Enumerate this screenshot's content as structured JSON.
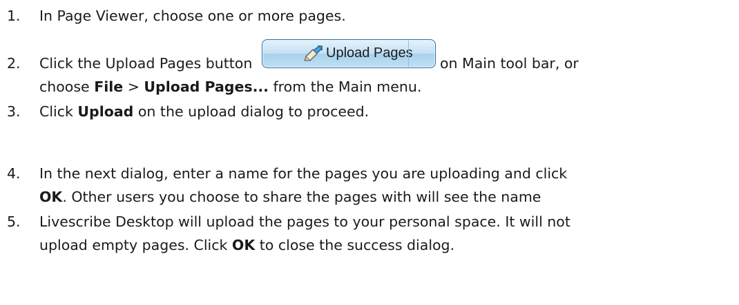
{
  "steps": [
    {
      "number": "1.",
      "text": "In Page Viewer, choose one or more pages."
    },
    {
      "number": "2.",
      "text_before_button": "Click the Upload Pages button",
      "button": {
        "label": "Upload Pages",
        "icon": "pen-upload-icon"
      },
      "text_after_button": "on Main tool bar, or",
      "line2_prefix": "choose",
      "bold_file": "File",
      "separator": ">",
      "bold_upload_pages": "Upload Pages...",
      "line2_suffix": "from the Main menu."
    },
    {
      "number": "3.",
      "prefix": "Click",
      "bold": "Upload",
      "suffix": "on the upload dialog to proceed."
    },
    {
      "number": "4.",
      "line1": "In the next dialog, enter a name for the pages you are uploading and click",
      "bold": "OK",
      "line2_suffix": ". Other users you choose to share the pages with will see the name"
    },
    {
      "number": "5.",
      "line1": "Livescribe Desktop will upload the pages to your personal space. It will not",
      "line2_prefix": "upload empty pages. Click",
      "bold": "OK",
      "line2_suffix": "to close the success dialog."
    }
  ],
  "colors": {
    "text": "#1a1a1a",
    "button_gradient_top": "#e6f3fb",
    "button_gradient_bottom": "#a8d1ec",
    "button_border": "#2f6f9e"
  }
}
